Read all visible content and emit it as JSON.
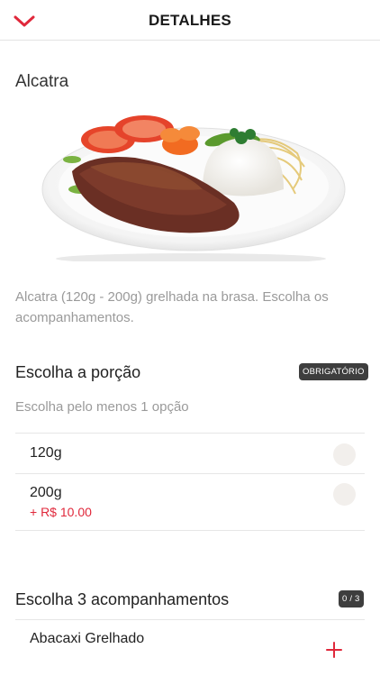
{
  "header": {
    "title": "DETALHES",
    "back_icon": "chevron-down-icon"
  },
  "product": {
    "name": "Alcatra",
    "image_alt": "Prato de alcatra grelhada com arroz, salada e molho",
    "description": "Alcatra (120g - 200g) grelhada na brasa. Escolha os acompanhamentos."
  },
  "portion": {
    "title": "Escolha a porção",
    "badge": "OBRIGATÓRIO",
    "subtitle": "Escolha pelo menos 1 opção",
    "options": [
      {
        "label": "120g",
        "price": ""
      },
      {
        "label": "200g",
        "price": "+ R$ 10.00"
      }
    ]
  },
  "sides": {
    "title": "Escolha 3 acompanhamentos",
    "counter": "0 / 3",
    "items": [
      {
        "label": "Abacaxi Grelhado"
      }
    ]
  },
  "colors": {
    "accent": "#e0283b",
    "badge_bg": "#3e3e3e"
  }
}
